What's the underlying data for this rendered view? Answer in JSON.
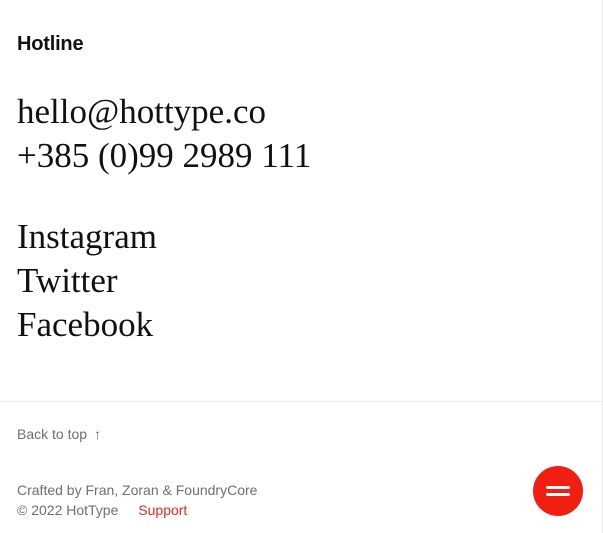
{
  "contact": {
    "heading": "Hotline",
    "email": "hello@hottype.co",
    "phone": "+385 (0)99 2989 111"
  },
  "social": {
    "items": [
      {
        "label": "Instagram"
      },
      {
        "label": "Twitter"
      },
      {
        "label": "Facebook"
      }
    ]
  },
  "footer": {
    "back_to_top_label": "Back to top",
    "back_to_top_arrow": "↑",
    "credits": "Crafted by Fran, Zoran & FoundryCore",
    "copyright": "© 2022 HotType",
    "support_label": "Support"
  },
  "menu_button": {
    "icon": "hamburger-icon"
  },
  "colors": {
    "accent": "#f01f12",
    "support_link": "#e32a1d",
    "muted_text": "#6f6f6f",
    "primary_text": "#111111",
    "divider": "#ececec"
  }
}
